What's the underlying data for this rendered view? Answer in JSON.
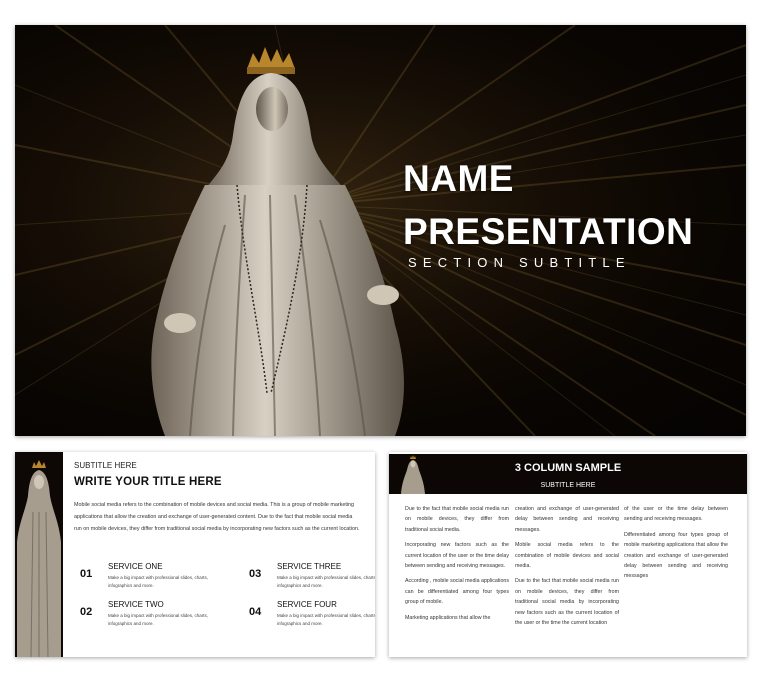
{
  "hero": {
    "title_line1": "NAME",
    "title_line2": "PRESENTATION",
    "subtitle": "SECTION SUBTITLE"
  },
  "slide2": {
    "subtitle": "SUBTITLE HERE",
    "title": "WRITE YOUR TITLE HERE",
    "paragraph": "Mobile social media refers to the combination of mobile devices and social media. This is a group of mobile marketing applications that allow the creation and exchange of user-generated content. Due to the fact that mobile social media run on mobile devices, they differ from traditional social media by incorporating new factors such as the current location.",
    "services": [
      {
        "num": "01",
        "name": "SERVICE ONE",
        "desc": "Make a big impact with professional slides, charts, infographics and more."
      },
      {
        "num": "02",
        "name": "SERVICE TWO",
        "desc": "Make a big impact with professional slides, charts, infographics and more."
      },
      {
        "num": "03",
        "name": "SERVICE THREE",
        "desc": "Make a big impact with professional slides, charts, infographics and more."
      },
      {
        "num": "04",
        "name": "SERVICE FOUR",
        "desc": "Make a big impact with professional slides, charts, infographics and more."
      }
    ]
  },
  "slide3": {
    "title": "3 COLUMN SAMPLE",
    "subtitle": "SUBTITLE HERE",
    "col1": [
      "Due to the fact that mobile social media run on mobile devices, they differ from traditional social media.",
      "Incorporating new factors such as the current location of the user or the time delay between sending and receiving messages.",
      "According , mobile social media applications can be differentiated among four types group of mobile.",
      "Marketing applications that allow the"
    ],
    "col2": [
      "creation and exchange of user-generated delay between sending and receiving messages.",
      "Mobile social media refers to the combination of mobile devices and social media.",
      "Due to the fact that mobile social media run on mobile devices, they differ from traditional social media by incorporating new factors such as the current location of the user or the time the current location"
    ],
    "col3": [
      "of the user or the time delay between sending and receiving messages.",
      "Differentiated among four types group of mobile marketing applications that allow the creation and exchange of user-generated delay between sending and receiving messages"
    ]
  }
}
